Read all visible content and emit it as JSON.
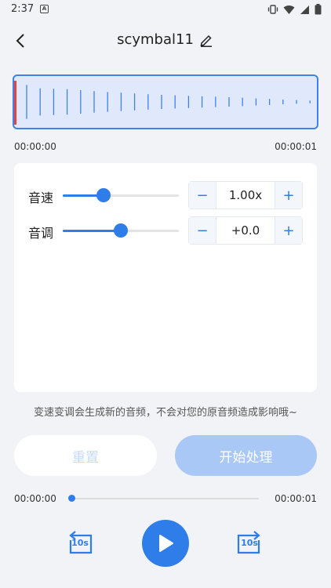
{
  "status": {
    "time": "2:37",
    "notification_letter": "A"
  },
  "header": {
    "title": "scymbal11"
  },
  "waveform": {
    "start_time": "00:00:00",
    "end_time": "00:00:01",
    "bar_levels": [
      0.72,
      0.58,
      0.56,
      0.54,
      0.5,
      0.46,
      0.42,
      0.39,
      0.36,
      0.33,
      0.3,
      0.28,
      0.26,
      0.24,
      0.22,
      0.2,
      0.18,
      0.15,
      0.13,
      0.1,
      0.08,
      0.06,
      0.04
    ]
  },
  "controls": {
    "speed": {
      "label": "音速",
      "value": "1.00x",
      "minus": "−",
      "plus": "+",
      "level": 0.35
    },
    "pitch": {
      "label": "音调",
      "value": "+0.0",
      "minus": "−",
      "plus": "+",
      "level": 0.5
    }
  },
  "hint": "变速变调会生成新的音频，不会对您的原音频造成影响哦~",
  "actions": {
    "reset_label": "重置",
    "start_label": "开始处理"
  },
  "player": {
    "current_time": "00:00:00",
    "total_time": "00:00:01",
    "progress": 0.0,
    "skip_back_label": "10s",
    "skip_forward_label": "10s"
  },
  "colors": {
    "accent": "#2f7de8",
    "playhead": "#e2433d",
    "background": "#f2f3f6"
  },
  "icons": {
    "back": "chevron-left-icon",
    "edit": "pencil-icon",
    "play": "play-icon",
    "skip_back": "replay-10-icon",
    "skip_forward": "forward-10-icon"
  }
}
